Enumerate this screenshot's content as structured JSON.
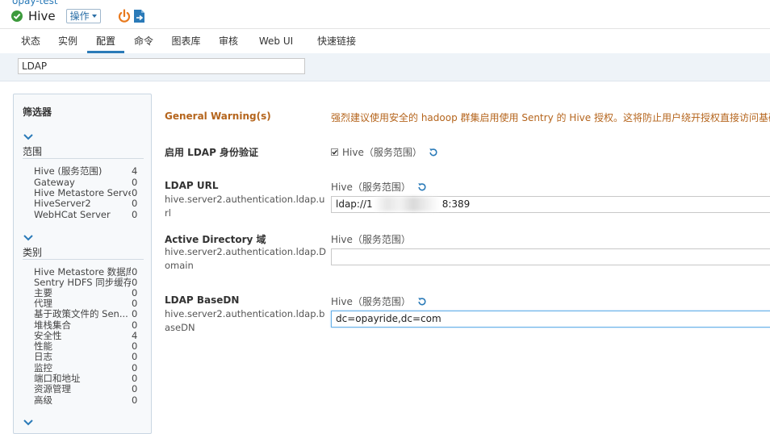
{
  "header": {
    "cluster_name": "opay-test",
    "service_name": "Hive",
    "actions_label": "操作"
  },
  "tabs": [
    {
      "label": "状态"
    },
    {
      "label": "实例"
    },
    {
      "label": "配置",
      "active": true
    },
    {
      "label": "命令"
    },
    {
      "label": "图表库"
    },
    {
      "label": "审核"
    },
    {
      "label": "Web UI",
      "dropdown": true
    },
    {
      "label": "快速链接",
      "dropdown": true
    }
  ],
  "search": {
    "value": "LDAP"
  },
  "filters": {
    "title": "筛选器",
    "groups": [
      {
        "title": "范围",
        "items": [
          {
            "label": "Hive (服务范围)",
            "count": "4"
          },
          {
            "label": "Gateway",
            "count": "0"
          },
          {
            "label": "Hive Metastore Server",
            "count": "0"
          },
          {
            "label": "HiveServer2",
            "count": "0"
          },
          {
            "label": "WebHCat Server",
            "count": "0"
          }
        ]
      },
      {
        "title": "类别",
        "items": [
          {
            "label": "Hive Metastore 数据库",
            "count": "0"
          },
          {
            "label": "Sentry HDFS 同步缓存",
            "count": "0"
          },
          {
            "label": "主要",
            "count": "0"
          },
          {
            "label": "代理",
            "count": "0"
          },
          {
            "label": "基于政策文件的 Sen...",
            "count": "0"
          },
          {
            "label": "堆栈集合",
            "count": "0"
          },
          {
            "label": "安全性",
            "count": "4"
          },
          {
            "label": "性能",
            "count": "0"
          },
          {
            "label": "日志",
            "count": "0"
          },
          {
            "label": "监控",
            "count": "0"
          },
          {
            "label": "端口和地址",
            "count": "0"
          },
          {
            "label": "资源管理",
            "count": "0"
          },
          {
            "label": "高级",
            "count": "0"
          }
        ]
      }
    ]
  },
  "config": {
    "warning": {
      "label": "General Warning(s)",
      "text": "强烈建议使用安全的 hadoop 群集启用使用 Sentry 的 Hive 授权。这将防止用户绕开授权直接访问基础数"
    },
    "enable_ldap": {
      "label": "启用 LDAP 身份验证",
      "scope": "Hive（服务范围）",
      "checked": true
    },
    "ldap_url": {
      "label": "LDAP URL",
      "key": "hive.server2.authentication.ldap.url",
      "scope": "Hive（服务范围）",
      "value_prefix": "ldap://1",
      "value_suffix": "8:389"
    },
    "ad_domain": {
      "label": "Active Directory 域",
      "key": "hive.server2.authentication.ldap.Domain",
      "scope": "Hive（服务范围）",
      "value": ""
    },
    "ldap_basedn": {
      "label": "LDAP BaseDN",
      "key": "hive.server2.authentication.ldap.baseDN",
      "scope": "Hive（服务范围）",
      "value": "dc=opayride,dc=com"
    }
  },
  "colors": {
    "accent": "#2a7ab8",
    "ok_green": "#3c9a3c",
    "warning_orange": "#b5651d",
    "power_orange": "#e8791d"
  }
}
